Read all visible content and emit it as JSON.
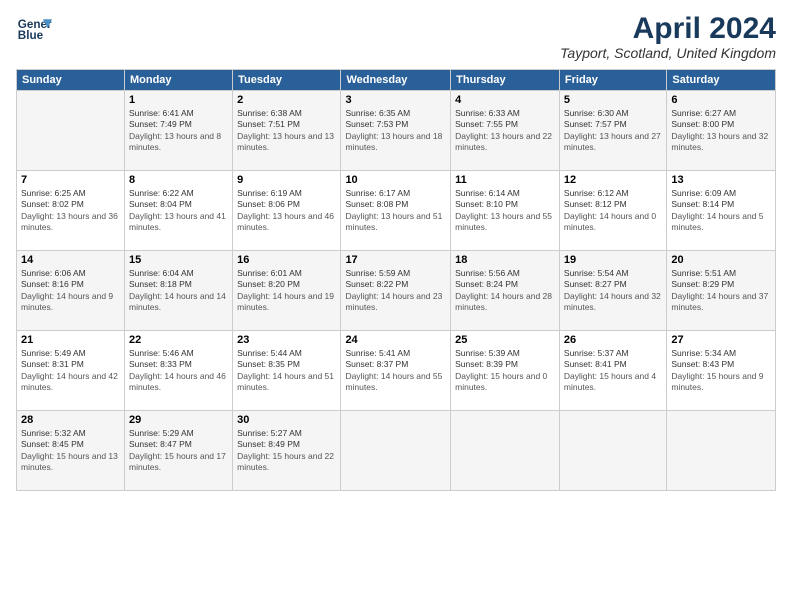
{
  "header": {
    "logo_line1": "General",
    "logo_line2": "Blue",
    "main_title": "April 2024",
    "subtitle": "Tayport, Scotland, United Kingdom"
  },
  "weekdays": [
    "Sunday",
    "Monday",
    "Tuesday",
    "Wednesday",
    "Thursday",
    "Friday",
    "Saturday"
  ],
  "weeks": [
    [
      {
        "day": "",
        "sunrise": "",
        "sunset": "",
        "daylight": ""
      },
      {
        "day": "1",
        "sunrise": "Sunrise: 6:41 AM",
        "sunset": "Sunset: 7:49 PM",
        "daylight": "Daylight: 13 hours and 8 minutes."
      },
      {
        "day": "2",
        "sunrise": "Sunrise: 6:38 AM",
        "sunset": "Sunset: 7:51 PM",
        "daylight": "Daylight: 13 hours and 13 minutes."
      },
      {
        "day": "3",
        "sunrise": "Sunrise: 6:35 AM",
        "sunset": "Sunset: 7:53 PM",
        "daylight": "Daylight: 13 hours and 18 minutes."
      },
      {
        "day": "4",
        "sunrise": "Sunrise: 6:33 AM",
        "sunset": "Sunset: 7:55 PM",
        "daylight": "Daylight: 13 hours and 22 minutes."
      },
      {
        "day": "5",
        "sunrise": "Sunrise: 6:30 AM",
        "sunset": "Sunset: 7:57 PM",
        "daylight": "Daylight: 13 hours and 27 minutes."
      },
      {
        "day": "6",
        "sunrise": "Sunrise: 6:27 AM",
        "sunset": "Sunset: 8:00 PM",
        "daylight": "Daylight: 13 hours and 32 minutes."
      }
    ],
    [
      {
        "day": "7",
        "sunrise": "Sunrise: 6:25 AM",
        "sunset": "Sunset: 8:02 PM",
        "daylight": "Daylight: 13 hours and 36 minutes."
      },
      {
        "day": "8",
        "sunrise": "Sunrise: 6:22 AM",
        "sunset": "Sunset: 8:04 PM",
        "daylight": "Daylight: 13 hours and 41 minutes."
      },
      {
        "day": "9",
        "sunrise": "Sunrise: 6:19 AM",
        "sunset": "Sunset: 8:06 PM",
        "daylight": "Daylight: 13 hours and 46 minutes."
      },
      {
        "day": "10",
        "sunrise": "Sunrise: 6:17 AM",
        "sunset": "Sunset: 8:08 PM",
        "daylight": "Daylight: 13 hours and 51 minutes."
      },
      {
        "day": "11",
        "sunrise": "Sunrise: 6:14 AM",
        "sunset": "Sunset: 8:10 PM",
        "daylight": "Daylight: 13 hours and 55 minutes."
      },
      {
        "day": "12",
        "sunrise": "Sunrise: 6:12 AM",
        "sunset": "Sunset: 8:12 PM",
        "daylight": "Daylight: 14 hours and 0 minutes."
      },
      {
        "day": "13",
        "sunrise": "Sunrise: 6:09 AM",
        "sunset": "Sunset: 8:14 PM",
        "daylight": "Daylight: 14 hours and 5 minutes."
      }
    ],
    [
      {
        "day": "14",
        "sunrise": "Sunrise: 6:06 AM",
        "sunset": "Sunset: 8:16 PM",
        "daylight": "Daylight: 14 hours and 9 minutes."
      },
      {
        "day": "15",
        "sunrise": "Sunrise: 6:04 AM",
        "sunset": "Sunset: 8:18 PM",
        "daylight": "Daylight: 14 hours and 14 minutes."
      },
      {
        "day": "16",
        "sunrise": "Sunrise: 6:01 AM",
        "sunset": "Sunset: 8:20 PM",
        "daylight": "Daylight: 14 hours and 19 minutes."
      },
      {
        "day": "17",
        "sunrise": "Sunrise: 5:59 AM",
        "sunset": "Sunset: 8:22 PM",
        "daylight": "Daylight: 14 hours and 23 minutes."
      },
      {
        "day": "18",
        "sunrise": "Sunrise: 5:56 AM",
        "sunset": "Sunset: 8:24 PM",
        "daylight": "Daylight: 14 hours and 28 minutes."
      },
      {
        "day": "19",
        "sunrise": "Sunrise: 5:54 AM",
        "sunset": "Sunset: 8:27 PM",
        "daylight": "Daylight: 14 hours and 32 minutes."
      },
      {
        "day": "20",
        "sunrise": "Sunrise: 5:51 AM",
        "sunset": "Sunset: 8:29 PM",
        "daylight": "Daylight: 14 hours and 37 minutes."
      }
    ],
    [
      {
        "day": "21",
        "sunrise": "Sunrise: 5:49 AM",
        "sunset": "Sunset: 8:31 PM",
        "daylight": "Daylight: 14 hours and 42 minutes."
      },
      {
        "day": "22",
        "sunrise": "Sunrise: 5:46 AM",
        "sunset": "Sunset: 8:33 PM",
        "daylight": "Daylight: 14 hours and 46 minutes."
      },
      {
        "day": "23",
        "sunrise": "Sunrise: 5:44 AM",
        "sunset": "Sunset: 8:35 PM",
        "daylight": "Daylight: 14 hours and 51 minutes."
      },
      {
        "day": "24",
        "sunrise": "Sunrise: 5:41 AM",
        "sunset": "Sunset: 8:37 PM",
        "daylight": "Daylight: 14 hours and 55 minutes."
      },
      {
        "day": "25",
        "sunrise": "Sunrise: 5:39 AM",
        "sunset": "Sunset: 8:39 PM",
        "daylight": "Daylight: 15 hours and 0 minutes."
      },
      {
        "day": "26",
        "sunrise": "Sunrise: 5:37 AM",
        "sunset": "Sunset: 8:41 PM",
        "daylight": "Daylight: 15 hours and 4 minutes."
      },
      {
        "day": "27",
        "sunrise": "Sunrise: 5:34 AM",
        "sunset": "Sunset: 8:43 PM",
        "daylight": "Daylight: 15 hours and 9 minutes."
      }
    ],
    [
      {
        "day": "28",
        "sunrise": "Sunrise: 5:32 AM",
        "sunset": "Sunset: 8:45 PM",
        "daylight": "Daylight: 15 hours and 13 minutes."
      },
      {
        "day": "29",
        "sunrise": "Sunrise: 5:29 AM",
        "sunset": "Sunset: 8:47 PM",
        "daylight": "Daylight: 15 hours and 17 minutes."
      },
      {
        "day": "30",
        "sunrise": "Sunrise: 5:27 AM",
        "sunset": "Sunset: 8:49 PM",
        "daylight": "Daylight: 15 hours and 22 minutes."
      },
      {
        "day": "",
        "sunrise": "",
        "sunset": "",
        "daylight": ""
      },
      {
        "day": "",
        "sunrise": "",
        "sunset": "",
        "daylight": ""
      },
      {
        "day": "",
        "sunrise": "",
        "sunset": "",
        "daylight": ""
      },
      {
        "day": "",
        "sunrise": "",
        "sunset": "",
        "daylight": ""
      }
    ]
  ]
}
